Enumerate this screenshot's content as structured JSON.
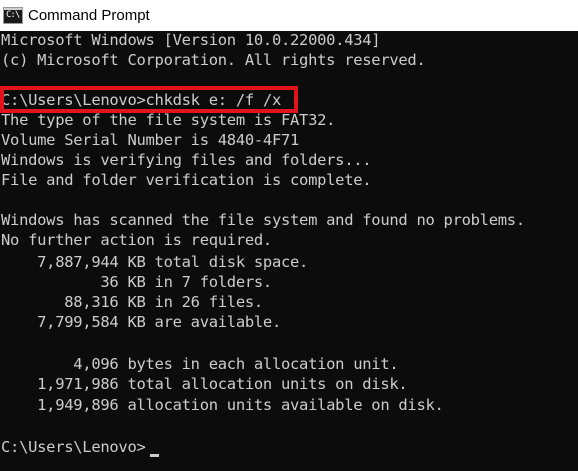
{
  "window": {
    "title": "Command Prompt",
    "icon": "cmd-icon",
    "icon_glyph": "C:\\"
  },
  "console": {
    "lines": [
      "Microsoft Windows [Version 10.0.22000.434]",
      "(c) Microsoft Corporation. All rights reserved.",
      "",
      "C:\\Users\\Lenovo>chkdsk e: /f /x",
      "The type of the file system is FAT32.",
      "Volume Serial Number is 4840-4F71",
      "Windows is verifying files and folders...",
      "File and folder verification is complete.",
      "",
      "Windows has scanned the file system and found no problems.",
      "No further action is required.",
      "    7,887,944 KB total disk space.",
      "           36 KB in 7 folders.",
      "       88,316 KB in 26 files.",
      "    7,799,584 KB are available.",
      "",
      "        4,096 bytes in each allocation unit.",
      "    1,971,986 total allocation units on disk.",
      "    1,949,896 allocation units available on disk.",
      "",
      "C:\\Users\\Lenovo>"
    ],
    "highlighted_command": "C:\\Users\\Lenovo>chkdsk e: /f /x",
    "prompt": "C:\\Users\\Lenovo>"
  },
  "colors": {
    "background": "#0c0c0c",
    "text": "#cccccc",
    "highlight_border": "#e1141b",
    "titlebar": "#ffffff"
  }
}
